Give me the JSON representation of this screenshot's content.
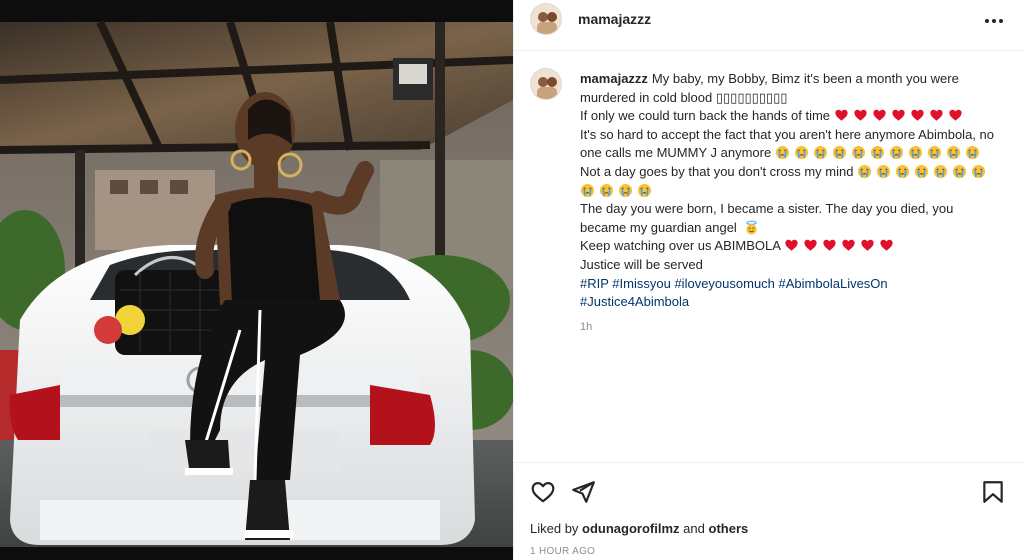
{
  "post": {
    "username": "mamajazzz",
    "more_icon": "more-options-icon"
  },
  "caption": {
    "username": "mamajazzz",
    "line1": "My baby, my Bobby, Bimz it's been a month you were murdered in cold blood ▯▯▯▯▯▯▯▯▯▯",
    "line2": "If only we could turn back the hands of time",
    "line2_hearts": 7,
    "line3": "It's so hard to accept the fact that you aren't here anymore Abimbola, no one calls me MUMMY J anymore",
    "line3_sobs": 11,
    "line4": "Not a day goes by that you don't cross my mind",
    "line4_sobs": 11,
    "line5": "The day you were born, I became a sister. The day you died, you became my guardian angel",
    "line6": "Keep watching over us ABIMBOLA",
    "line6_hearts": 6,
    "line7": "Justice will be served",
    "hashtags_line1": [
      "#RIP",
      "#Imissyou",
      "#iloveyousomuch",
      "#AbimbolaLivesOn"
    ],
    "hashtags_line2": [
      "#Justice4Abimbola"
    ],
    "relative_time": "1h",
    "heart_color": "#e0112b",
    "sob_color": "#f7c23a"
  },
  "actions": {
    "like_icon": "heart-outline-icon",
    "share_icon": "paper-plane-icon",
    "save_icon": "bookmark-icon",
    "liked_by_prefix": "Liked by",
    "liked_by_user": "odunagorofilmz",
    "liked_by_joiner": "and",
    "liked_by_others": "others",
    "timestamp": "1 HOUR AGO"
  }
}
